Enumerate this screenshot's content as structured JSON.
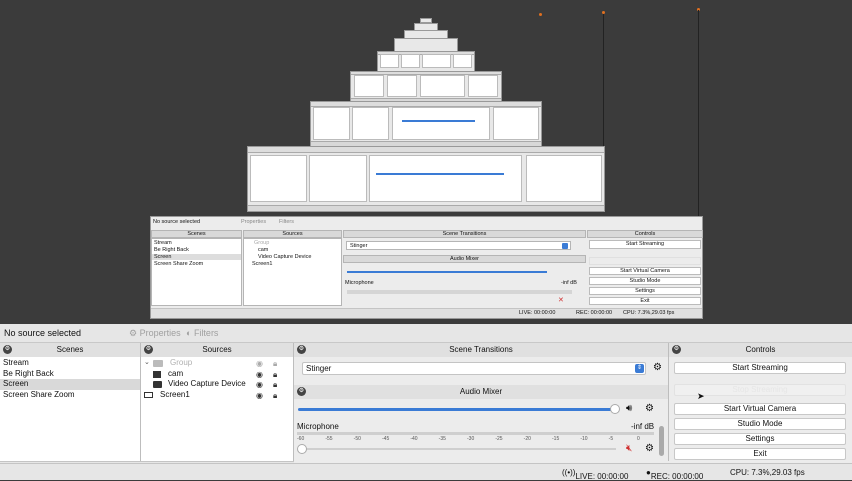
{
  "preview": {
    "snapshot": {
      "no_source": "No source selected",
      "properties": "Properties",
      "filters": "Filters",
      "scenes_header": "Scenes",
      "sources_header": "Sources",
      "transitions_header": "Scene Transitions",
      "controls_header": "Controls",
      "audio_header": "Audio Mixer",
      "scenes": [
        "Stream",
        "Be Right Back",
        "Screen",
        "Screen Share Zoom"
      ],
      "sources": [
        "Group",
        "cam",
        "Video Capture Device",
        "Screen1"
      ],
      "transition": "Stinger",
      "mic_label": "Microphone",
      "mic_db": "-inf dB",
      "buttons": [
        "Start Streaming",
        "",
        "Start Virtual Camera",
        "Studio Mode",
        "Settings",
        "Exit"
      ],
      "live": "LIVE: 00:00:00",
      "rec": "REC: 00:00:00",
      "cpu": "CPU: 7.3%,29.03 fps"
    }
  },
  "top": {
    "no_source": "No source selected",
    "properties": "Properties",
    "filters": "Filters"
  },
  "scenes": {
    "header": "Scenes",
    "items": [
      "Stream",
      "Be Right Back",
      "Screen",
      "Screen Share Zoom"
    ],
    "selected_index": 2
  },
  "sources": {
    "header": "Sources",
    "items": [
      {
        "label": "Group",
        "type": "folder",
        "dim": true
      },
      {
        "label": "cam",
        "type": "image"
      },
      {
        "label": "Video Capture Device",
        "type": "camera"
      },
      {
        "label": "Screen1",
        "type": "display"
      }
    ]
  },
  "transitions": {
    "header": "Scene Transitions",
    "value": "Stinger"
  },
  "audio": {
    "header": "Audio Mixer",
    "mic_label": "Microphone",
    "mic_db": "-inf dB",
    "scale": [
      "-60",
      "-55",
      "-50",
      "-45",
      "-40",
      "-35",
      "-30",
      "-25",
      "-20",
      "-15",
      "-10",
      "-5",
      "0"
    ]
  },
  "controls": {
    "header": "Controls",
    "start_streaming": "Start Streaming",
    "stop_streaming": "Stop Streaming",
    "start_virtual_camera": "Start Virtual Camera",
    "studio_mode": "Studio Mode",
    "settings": "Settings",
    "exit": "Exit"
  },
  "status": {
    "live": "LIVE: 00:00:00",
    "rec": "REC: 00:00:00",
    "cpu": "CPU: 7.3%,29.03 fps"
  },
  "colors": {
    "background": "#3b3b3b",
    "panel": "#ececec",
    "accent": "#3a7bd5",
    "mute_red": "#d03030"
  }
}
